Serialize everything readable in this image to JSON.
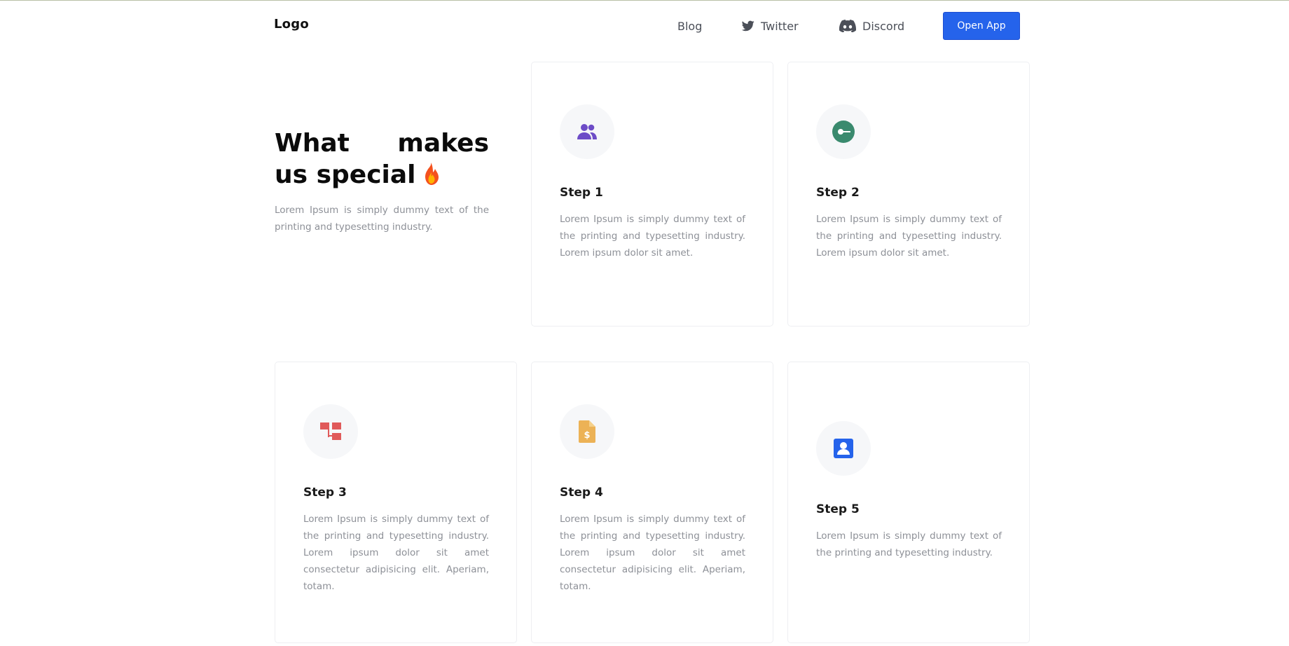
{
  "header": {
    "logo": "Logo",
    "nav": {
      "blog": "Blog",
      "twitter": "Twitter",
      "discord": "Discord"
    },
    "cta": "Open App"
  },
  "hero": {
    "title": "What makes us special",
    "description": "Lorem Ipsum is simply dummy text of the printing and typesetting industry."
  },
  "icons": {
    "step1": "users-icon",
    "step2": "target-icon",
    "step3": "sitemap-icon",
    "step4": "invoice-dollar-icon",
    "step5": "contact-card-icon",
    "hero": "fire-icon"
  },
  "colors": {
    "accent": "#2563eb",
    "step1_icon": "#6d4cc7",
    "step2_icon": "#3a8a6e",
    "step3_icon": "#e05a5a",
    "step4_icon": "#ecb256",
    "step5_icon": "#2563eb"
  },
  "cards": [
    {
      "title": "Step 1",
      "text": "Lorem Ipsum is simply dummy text of the printing and typesetting industry. Lorem ipsum dolor sit amet."
    },
    {
      "title": "Step 2",
      "text": "Lorem Ipsum is simply dummy text of the printing and typesetting industry. Lorem ipsum dolor sit amet."
    },
    {
      "title": "Step 3",
      "text": "Lorem Ipsum is simply dummy text of the printing and typesetting industry. Lorem ipsum dolor sit amet consectetur adipisicing elit. Aperiam, totam."
    },
    {
      "title": "Step 4",
      "text": "Lorem Ipsum is simply dummy text of the printing and typesetting industry. Lorem ipsum dolor sit amet consectetur adipisicing elit. Aperiam, totam."
    },
    {
      "title": "Step 5",
      "text": "Lorem Ipsum is simply dummy text of the printing and typesetting industry."
    }
  ]
}
